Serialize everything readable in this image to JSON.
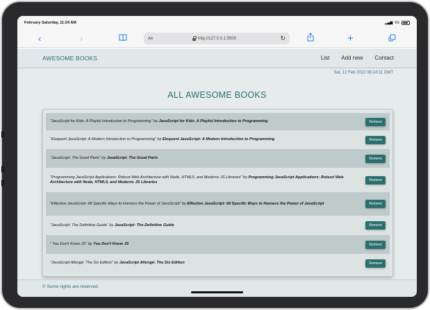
{
  "status": {
    "datetime": "February Saturday, 11:24 AM",
    "signal": "5G"
  },
  "browser": {
    "aa_label": "AA",
    "url": "http://127.0.0.1:5500"
  },
  "nav": {
    "brand": "AWESOME BOOKS",
    "links": [
      "List",
      "Add new",
      "Contact"
    ]
  },
  "date_text": "Sat, 12 Feb 2022 08:24:11 GMT",
  "title": "ALL AWESOME BOOKS",
  "books": [
    {
      "title": "\"JavaScript for Kids: A Playful Introduction to Programming\"",
      "by": " by ",
      "author": "JavaScript for Kids: A Playful Introduction to Programming",
      "button": "Remove"
    },
    {
      "title": "\"Eloquent JavaScript: A Modern Introduction to Programming\"",
      "by": " by ",
      "author": "Eloquent JavaScript: A Modern Introduction to Programming",
      "button": "Remove"
    },
    {
      "title": "\"JavaScript: The Good Parts\"",
      "by": " by ",
      "author": "JavaScript: The Good Parts",
      "button": "Remove"
    },
    {
      "title": "\"Programming JavaScript Applications: Robust Web Architecture with Node, HTML5, and Moderns JS Libraries\"",
      "by": " by ",
      "author": "Programming JavaScript Applications: Robust Web Architecture with Node, HTML5, and Moderns JS Libraries",
      "button": "Remove"
    },
    {
      "title": "\"Effective JavaScript: 68 Specific Ways to Harness the Power of JavaScript\"",
      "by": " by ",
      "author": "Effective JavaScript: 68 Specific Ways to Harness the Power of JavaScript",
      "button": "Remove"
    },
    {
      "title": "\"JavaScript: The Definitive Guide\"",
      "by": " by ",
      "author": "JavaScript: The Definitive Guide",
      "button": "Remove"
    },
    {
      "title": "\" You Don't Know JS\"",
      "by": " by ",
      "author": "You Don't Know JS",
      "button": "Remove"
    },
    {
      "title": "\"JavaScript Allongé: The Six Edition\"",
      "by": " by ",
      "author": "JavaScript Allongé: The Six Edition",
      "button": "Remove"
    }
  ],
  "footer": "© Some rights are reserved.",
  "colors": {
    "accent": "#2b6e6e",
    "page_bg": "#e6ecec",
    "row_dark": "#bfcaca",
    "row_light": "#dde3e3",
    "browser_blue": "#2a7ae2"
  }
}
